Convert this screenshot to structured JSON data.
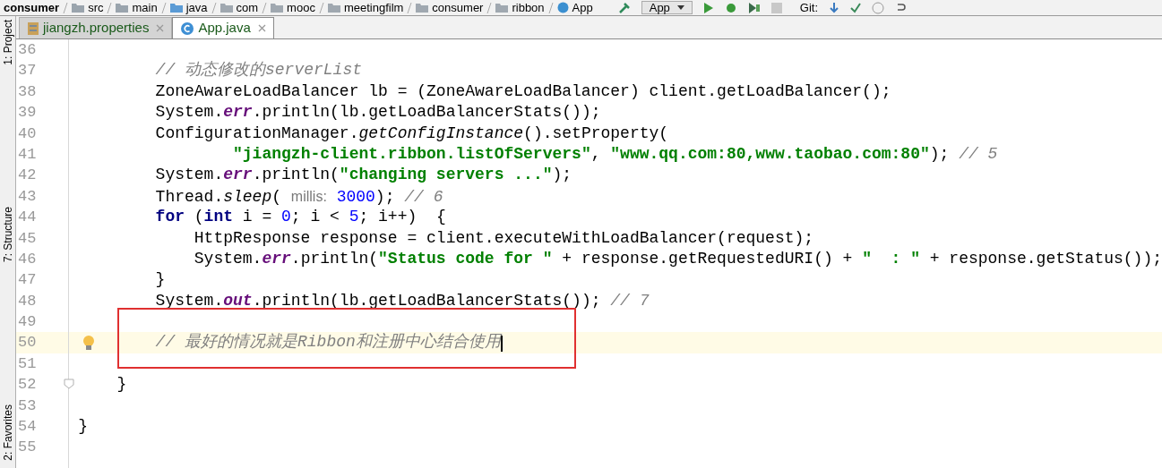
{
  "breadcrumbs": [
    {
      "label": "consumer",
      "kind": "module"
    },
    {
      "label": "src",
      "kind": "folder"
    },
    {
      "label": "main",
      "kind": "folder"
    },
    {
      "label": "java",
      "kind": "source"
    },
    {
      "label": "com",
      "kind": "package"
    },
    {
      "label": "mooc",
      "kind": "package"
    },
    {
      "label": "meetingfilm",
      "kind": "package"
    },
    {
      "label": "consumer",
      "kind": "package"
    },
    {
      "label": "ribbon",
      "kind": "package"
    },
    {
      "label": "App",
      "kind": "class"
    }
  ],
  "toolbar": {
    "run_config": "App",
    "vcs_label": "Git:"
  },
  "side_tabs": [
    "1: Project",
    "7: Structure",
    "2: Favorites"
  ],
  "tabs": [
    {
      "label": "jiangzh.properties",
      "kind": "properties",
      "selected": false
    },
    {
      "label": "App.java",
      "kind": "class",
      "selected": true
    }
  ],
  "lines": [
    {
      "number": "36",
      "current": false,
      "bulb": false,
      "foldable": false
    },
    {
      "number": "37",
      "current": false,
      "bulb": false,
      "foldable": false,
      "tokens": [
        {
          "kind": "comment",
          "text": "        // 动态修改的serverList"
        }
      ]
    },
    {
      "number": "38",
      "current": false,
      "bulb": false,
      "foldable": false,
      "tokens": [
        {
          "kind": "plain",
          "text": "        ZoneAwareLoadBalancer lb = (ZoneAwareLoadBalancer) client.getLoadBalancer();"
        }
      ]
    },
    {
      "number": "39",
      "current": false,
      "bulb": false,
      "foldable": false,
      "tokens": [
        {
          "kind": "plain",
          "text": "        System."
        },
        {
          "kind": "field",
          "text": "err"
        },
        {
          "kind": "plain",
          "text": ".println(lb.getLoadBalancerStats());"
        }
      ]
    },
    {
      "number": "40",
      "current": false,
      "bulb": false,
      "foldable": false,
      "tokens": [
        {
          "kind": "plain",
          "text": "        ConfigurationManager."
        },
        {
          "kind": "static",
          "text": "getConfigInstance"
        },
        {
          "kind": "plain",
          "text": "().setProperty("
        }
      ]
    },
    {
      "number": "41",
      "current": false,
      "bulb": false,
      "foldable": false,
      "tokens": [
        {
          "kind": "string",
          "text": "                \"jiangzh-client.ribbon.listOfServers\""
        },
        {
          "kind": "plain",
          "text": ", "
        },
        {
          "kind": "string",
          "text": "\"www.qq.com:80,www.taobao.com:80\""
        },
        {
          "kind": "plain",
          "text": "); "
        },
        {
          "kind": "comment",
          "text": "// 5"
        }
      ]
    },
    {
      "number": "42",
      "current": false,
      "bulb": false,
      "foldable": false,
      "tokens": [
        {
          "kind": "plain",
          "text": "        System."
        },
        {
          "kind": "field",
          "text": "err"
        },
        {
          "kind": "plain",
          "text": ".println("
        },
        {
          "kind": "string",
          "text": "\"changing servers ...\""
        },
        {
          "kind": "plain",
          "text": ");"
        }
      ]
    },
    {
      "number": "43",
      "current": false,
      "bulb": false,
      "foldable": false,
      "tokens": [
        {
          "kind": "plain",
          "text": "        Thread."
        },
        {
          "kind": "static",
          "text": "sleep"
        },
        {
          "kind": "plain",
          "text": "( "
        },
        {
          "kind": "hint",
          "text": "millis:"
        },
        {
          "kind": "number",
          "text": " 3000"
        },
        {
          "kind": "plain",
          "text": "); "
        },
        {
          "kind": "comment",
          "text": "// 6"
        }
      ]
    },
    {
      "number": "44",
      "current": false,
      "bulb": false,
      "foldable": false,
      "tokens": [
        {
          "kind": "keyword",
          "text": "        for"
        },
        {
          "kind": "plain",
          "text": " ("
        },
        {
          "kind": "keyword",
          "text": "int"
        },
        {
          "kind": "plain",
          "text": " i = "
        },
        {
          "kind": "number",
          "text": "0"
        },
        {
          "kind": "plain",
          "text": "; i < "
        },
        {
          "kind": "number",
          "text": "5"
        },
        {
          "kind": "plain",
          "text": "; i++)  {"
        }
      ]
    },
    {
      "number": "45",
      "current": false,
      "bulb": false,
      "foldable": false,
      "tokens": [
        {
          "kind": "plain",
          "text": "            HttpResponse response = client.executeWithLoadBalancer(request);"
        }
      ]
    },
    {
      "number": "46",
      "current": false,
      "bulb": false,
      "foldable": false,
      "tokens": [
        {
          "kind": "plain",
          "text": "            System."
        },
        {
          "kind": "field",
          "text": "err"
        },
        {
          "kind": "plain",
          "text": ".println("
        },
        {
          "kind": "string",
          "text": "\"Status code for \""
        },
        {
          "kind": "plain",
          "text": " + response.getRequestedURI() + "
        },
        {
          "kind": "string",
          "text": "\"  : \""
        },
        {
          "kind": "plain",
          "text": " + response.getStatus());"
        }
      ]
    },
    {
      "number": "47",
      "current": false,
      "bulb": false,
      "foldable": false,
      "tokens": [
        {
          "kind": "plain",
          "text": "        }"
        }
      ]
    },
    {
      "number": "48",
      "current": false,
      "bulb": false,
      "foldable": false,
      "tokens": [
        {
          "kind": "plain",
          "text": "        System."
        },
        {
          "kind": "field",
          "text": "out"
        },
        {
          "kind": "plain",
          "text": ".println(lb.getLoadBalancerStats()); "
        },
        {
          "kind": "comment",
          "text": "// 7"
        }
      ]
    },
    {
      "number": "49",
      "current": false,
      "bulb": false,
      "foldable": false
    },
    {
      "number": "50",
      "current": true,
      "bulb": true,
      "foldable": false,
      "tokens": [
        {
          "kind": "comment",
          "text": "        // 最好的情况就是Ribbon和注册中心结合使用"
        }
      ]
    },
    {
      "number": "51",
      "current": false,
      "bulb": false,
      "foldable": false
    },
    {
      "number": "52",
      "current": false,
      "bulb": false,
      "foldable": true,
      "tokens": [
        {
          "kind": "plain",
          "text": "    }"
        }
      ]
    },
    {
      "number": "53",
      "current": false,
      "bulb": false,
      "foldable": false
    },
    {
      "number": "54",
      "current": false,
      "bulb": false,
      "foldable": false,
      "tokens": [
        {
          "kind": "plain",
          "text": "}"
        }
      ]
    },
    {
      "number": "55",
      "current": false,
      "bulb": false,
      "foldable": false
    }
  ]
}
